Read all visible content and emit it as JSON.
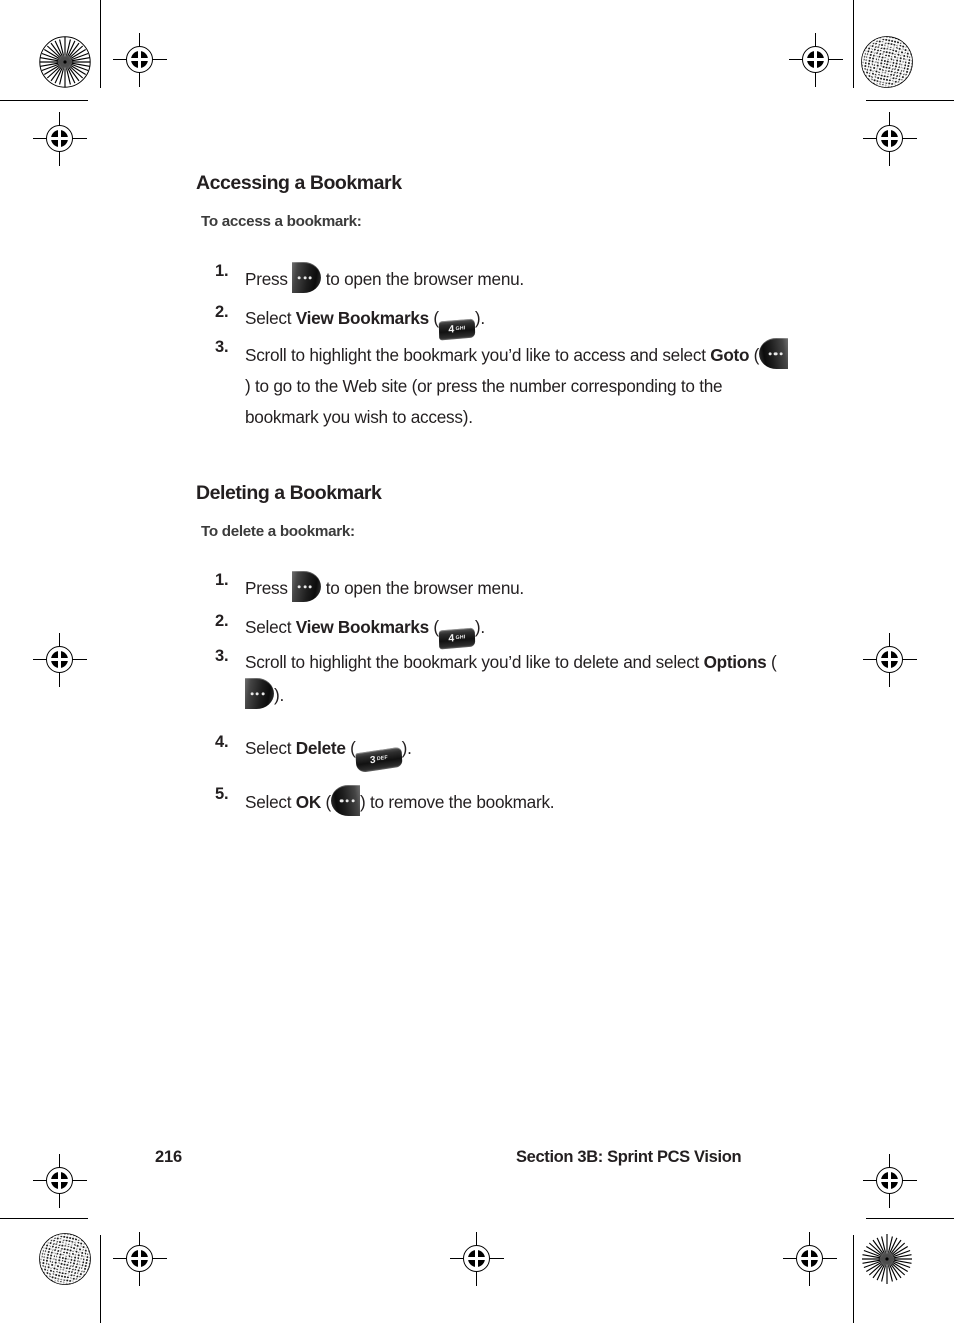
{
  "page": {
    "number": "216",
    "section_footer": "Section 3B: Sprint PCS Vision"
  },
  "sections": [
    {
      "heading": "Accessing a Bookmark",
      "subhead": "To access a bookmark:",
      "steps": [
        {
          "num": "1.",
          "before": "Press ",
          "key": "softkey-right-menu",
          "after": " to open the browser menu."
        },
        {
          "num": "2.",
          "before": "Select ",
          "bold": "View Bookmarks",
          "paren_open": " (",
          "key": "numkey-4-ghi",
          "paren_close": ")."
        },
        {
          "num": "3.",
          "before": "Scroll to highlight the bookmark you’d like to access and select ",
          "bold": "Goto",
          "paren_open": " (",
          "key": "softkey-left-goto",
          "paren_close": ") to go to the Web site (or press the number corresponding to the bookmark you wish to access)."
        }
      ]
    },
    {
      "heading": "Deleting a Bookmark",
      "subhead": "To delete a bookmark:",
      "steps": [
        {
          "num": "1.",
          "before": "Press ",
          "key": "softkey-right-menu",
          "after": " to open the browser menu."
        },
        {
          "num": "2.",
          "before": "Select ",
          "bold": "View Bookmarks",
          "paren_open": " (",
          "key": "numkey-4-ghi",
          "paren_close": ")."
        },
        {
          "num": "3.",
          "before": "Scroll to highlight the bookmark you’d like to delete and select ",
          "bold": "Options",
          "paren_open": " (",
          "key": "softkey-right-options",
          "paren_close": ")."
        },
        {
          "num": "4.",
          "before": "Select ",
          "bold": "Delete",
          "paren_open": " (",
          "key": "numkey-3-def",
          "paren_close": ")."
        },
        {
          "num": "5.",
          "before": "Select ",
          "bold": "OK",
          "paren_open": " (",
          "key": "softkey-left-ok",
          "paren_close": ") to remove the bookmark."
        }
      ]
    }
  ],
  "keys": {
    "numkey-4-ghi": {
      "digit": "4",
      "letters": "GHI"
    },
    "numkey-3-def": {
      "digit": "3",
      "letters": "DEF"
    }
  },
  "colors": {
    "text": "#231f20",
    "subhead": "#3b3b3b",
    "page_background": "#ffffff",
    "mark": "#000000"
  }
}
